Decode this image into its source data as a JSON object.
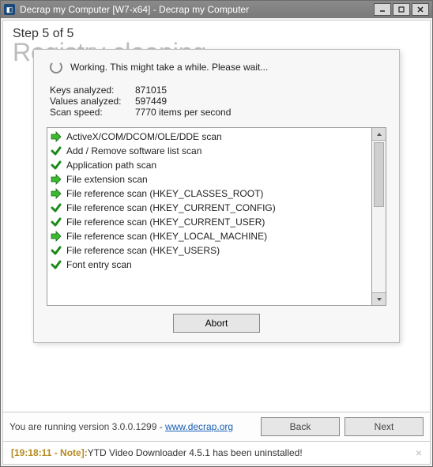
{
  "window": {
    "title": "Decrap my Computer [W7-x64] - Decrap my Computer"
  },
  "header": {
    "step": "Step 5 of 5",
    "title": "Registry cleaning"
  },
  "dialog": {
    "working": "Working. This might take a while. Please wait...",
    "stats": {
      "keys_label": "Keys analyzed:",
      "keys_value": "871015",
      "values_label": "Values analyzed:",
      "values_value": "597449",
      "speed_label": "Scan speed:",
      "speed_value": "7770 items per second"
    },
    "items": [
      {
        "icon": "arrow",
        "label": "ActiveX/COM/DCOM/OLE/DDE scan"
      },
      {
        "icon": "check",
        "label": "Add / Remove software list scan"
      },
      {
        "icon": "check",
        "label": "Application path scan"
      },
      {
        "icon": "arrow",
        "label": "File extension scan"
      },
      {
        "icon": "arrow",
        "label": "File reference scan (HKEY_CLASSES_ROOT)"
      },
      {
        "icon": "check",
        "label": "File reference scan (HKEY_CURRENT_CONFIG)"
      },
      {
        "icon": "check",
        "label": "File reference scan (HKEY_CURRENT_USER)"
      },
      {
        "icon": "arrow",
        "label": "File reference scan (HKEY_LOCAL_MACHINE)"
      },
      {
        "icon": "check",
        "label": "File reference scan (HKEY_USERS)"
      },
      {
        "icon": "check",
        "label": "Font entry scan"
      }
    ],
    "abort": "Abort"
  },
  "footer": {
    "version_prefix": "You are running version 3.0.0.1299 - ",
    "link_text": "www.decrap.org",
    "back": "Back",
    "next": "Next"
  },
  "log": {
    "stamp": "[19:18:11 - Note]:",
    "msg": " YTD Video Downloader 4.5.1 has been uninstalled!"
  }
}
